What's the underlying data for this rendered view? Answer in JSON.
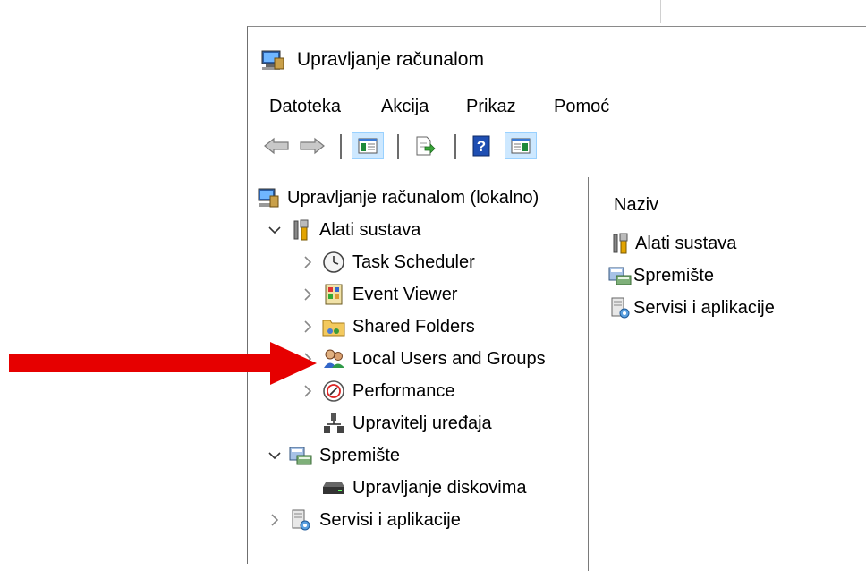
{
  "window": {
    "title": "Upravljanje računalom"
  },
  "menu": {
    "items": [
      "Datoteka",
      "Akcija",
      "Prikaz",
      "Pomoć"
    ]
  },
  "toolbar": {
    "icons": [
      "back-arrow-icon",
      "forward-arrow-icon",
      "show-hide-console-tree-icon",
      "export-list-icon",
      "help-icon",
      "show-hide-action-pane-icon"
    ]
  },
  "tree": {
    "root": "Upravljanje računalom (lokalno)",
    "items": [
      {
        "label": "Alati sustava",
        "icon": "tools-icon",
        "expanded": true
      },
      {
        "label": "Task Scheduler",
        "icon": "clock-icon"
      },
      {
        "label": "Event Viewer",
        "icon": "event-viewer-icon"
      },
      {
        "label": "Shared Folders",
        "icon": "shared-folder-icon"
      },
      {
        "label": "Local Users and Groups",
        "icon": "users-icon"
      },
      {
        "label": "Performance",
        "icon": "performance-icon"
      },
      {
        "label": "Upravitelj uređaja",
        "icon": "device-manager-icon"
      },
      {
        "label": "Spremište",
        "icon": "storage-icon",
        "expanded": true
      },
      {
        "label": "Upravljanje diskovima",
        "icon": "disk-icon"
      },
      {
        "label": "Servisi i aplikacije",
        "icon": "services-icon"
      }
    ]
  },
  "detail": {
    "header": "Naziv",
    "items": [
      "Alati sustava",
      "Spremište",
      "Servisi i aplikacije"
    ]
  },
  "annotation": {
    "color": "#e60000"
  }
}
